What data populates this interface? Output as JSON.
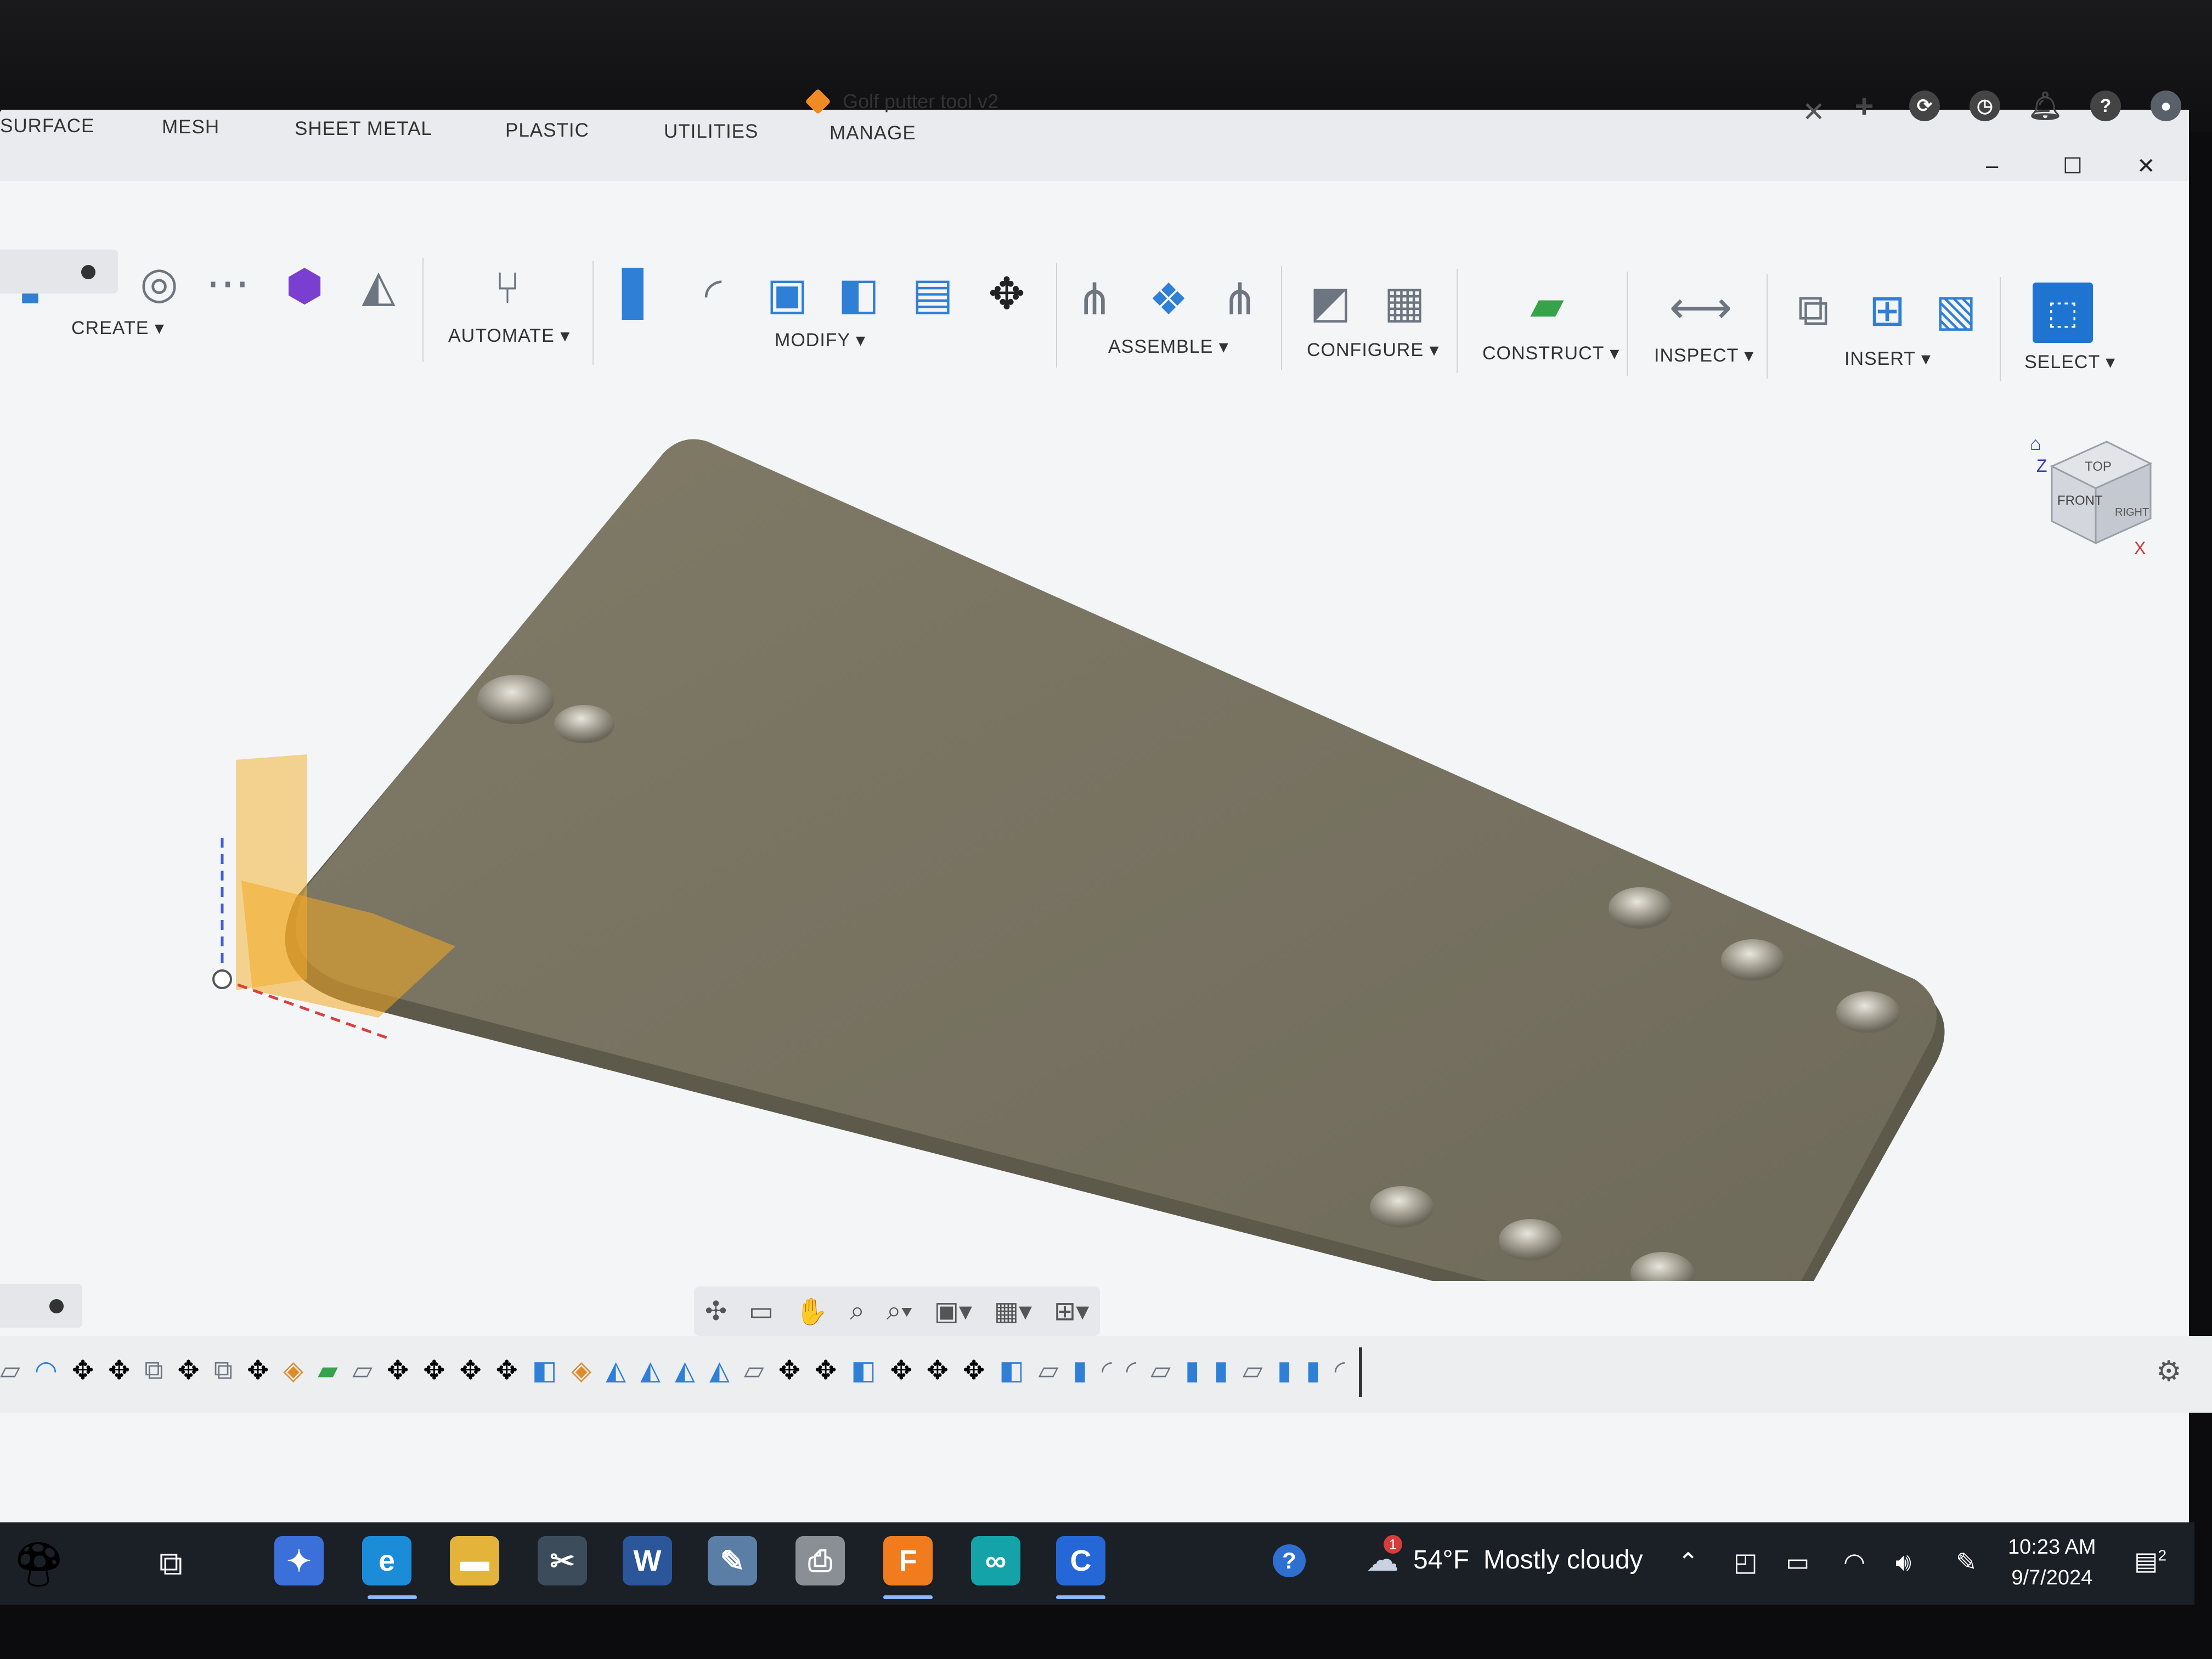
{
  "window": {
    "title": "Golf putter tool v2",
    "minimize": "–",
    "maximize": "☐",
    "close": "✕"
  },
  "tabs": [
    "SURFACE",
    "MESH",
    "SHEET METAL",
    "PLASTIC",
    "UTILITIES",
    "MANAGE"
  ],
  "toolbar": {
    "create": "CREATE ▾",
    "automate": "AUTOMATE ▾",
    "modify": "MODIFY ▾",
    "assemble": "ASSEMBLE ▾",
    "configure": "CONFIGURE ▾",
    "construct": "CONSTRUCT ▾",
    "inspect": "INSPECT ▾",
    "insert": "INSERT ▾",
    "select": "SELECT ▾"
  },
  "header_icons": [
    "plus-icon",
    "sync-icon",
    "history-icon",
    "bell-icon",
    "help-icon",
    "avatar"
  ],
  "viewcube": {
    "top": "TOP",
    "front": "FRONT",
    "right": "RIGHT",
    "z": "Z",
    "x": "X"
  },
  "taskbar": {
    "weather_temp": "54°F",
    "weather_text": "Mostly cloudy",
    "weather_badge": "1",
    "time": "10:23 AM",
    "date": "9/7/2024",
    "notif_count": "2",
    "apps": [
      {
        "name": "copilot",
        "label": "✦",
        "color": "#3b6fd9"
      },
      {
        "name": "edge",
        "label": "e",
        "color": "#1a8cd8"
      },
      {
        "name": "file-explorer",
        "label": "▬",
        "color": "#e4b43a"
      },
      {
        "name": "snipping",
        "label": "✂",
        "color": "#3c4c5a"
      },
      {
        "name": "word",
        "label": "W",
        "color": "#2b579a"
      },
      {
        "name": "paint",
        "label": "✎",
        "color": "#5a7ea6"
      },
      {
        "name": "printer",
        "label": "⎙",
        "color": "#8a8f96"
      },
      {
        "name": "fusion",
        "label": "F",
        "color": "#f07c1e"
      },
      {
        "name": "arduino",
        "label": "∞",
        "color": "#13a3a8"
      },
      {
        "name": "c-app",
        "label": "C",
        "color": "#2667d8"
      }
    ]
  }
}
